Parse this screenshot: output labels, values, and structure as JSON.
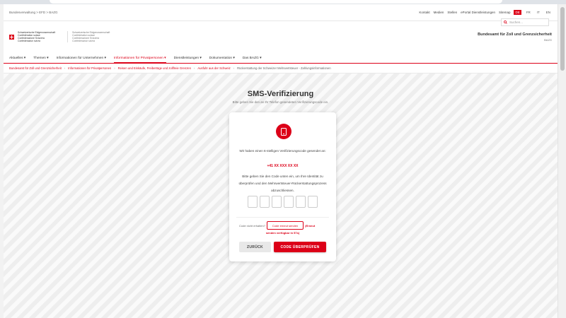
{
  "service_bar": {
    "breadcrumb": "Bundesverwaltung > EFD > BAZG",
    "links": [
      "Kontakt",
      "Medien",
      "Stellen",
      "ePortal Dienstleistungen",
      "Sitemap"
    ],
    "languages": [
      "DE",
      "FR",
      "IT",
      "EN"
    ],
    "active_language": "DE",
    "search_placeholder": "Suchen..."
  },
  "header": {
    "confed_names": [
      "Schweizerische Eidgenossenschaft",
      "Confédération suisse",
      "Confederazione Svizzera",
      "Confederaziun svizra"
    ],
    "office_title": "Bundesamt für Zoll und Grenzsicherheit",
    "office_abbr": "BAZG"
  },
  "nav": {
    "items": [
      "Aktuelles ▾",
      "Themen ▾",
      "Informationen für Unternehmen ▾",
      "Informationen für Privatpersonen ▾",
      "Dienstleistungen ▾",
      "Dokumentation ▾",
      "Das BAZG ▾"
    ],
    "active_index": 3
  },
  "breadcrumb": [
    "Bundesamt für Zoll und Grenzsicherheit",
    "Informationen für Privatpersonen",
    "Reisen und Einkäufe, Freibeträge und zollfreie Grenzen",
    "Ausfuhr aus der Schweiz",
    "Rückerstattung der Schweizer Mehrwertsteuer - Zahlungsinformationen"
  ],
  "main": {
    "title": "SMS-Verifizierung",
    "subtitle": "Bitte geben Sie den an Ihr Telefon gesendeten Verifizierungscode ein."
  },
  "card": {
    "icon": "phone-icon",
    "sent_message": "Wir haben einen 6-stelligen Verifizierungscode gesendet an:",
    "phone_number": "+41 XX XXX XX XX",
    "instruction": "Bitte geben Sie den Code unten ein, um Ihre Identität zu überprüfen und den Mehrwertsteuer-Rückerstattungsprozess abzuschliessen.",
    "code_digits": [
      "",
      "",
      "",
      "",
      "",
      ""
    ],
    "resend_question": "Code nicht erhalten?",
    "resend_button": "Code erneut senden",
    "resend_note_a": "(Erneut",
    "resend_note_b": "senden verfügbar in 57s)",
    "back_button": "ZURÜCK",
    "verify_button": "CODE ÜBERPRÜFEN"
  },
  "colors": {
    "accent": "#dc0018",
    "background": "#f3f3f3"
  }
}
